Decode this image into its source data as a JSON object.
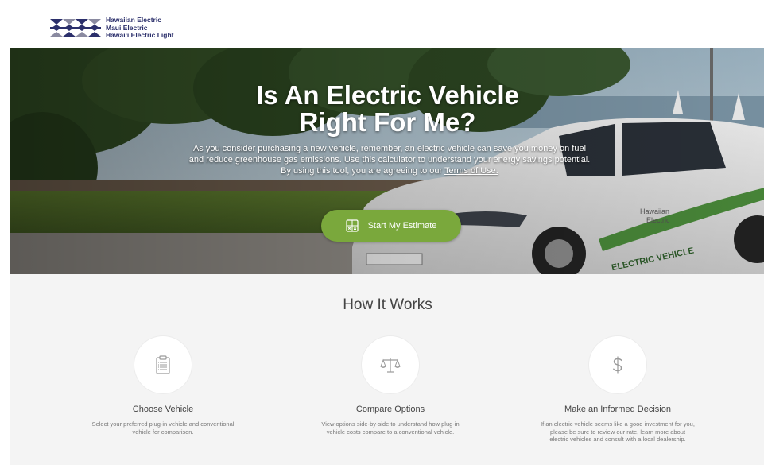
{
  "header": {
    "logo_lines": [
      "Hawaiian Electric",
      "Maui Electric",
      "Hawai‘i Electric Light"
    ]
  },
  "hero": {
    "title_line1": "Is An Electric Vehicle",
    "title_line2": "Right For Me?",
    "description": "As you consider purchasing a new vehicle, remember, an electric vehicle can save you money on fuel and reduce greenhouse gas emissions. Use this calculator to understand your energy savings potential. By using this tool, you are agreeing to our ",
    "terms_link": "Terms of Use.",
    "cta_label": "Start My Estimate",
    "cta_icon": "calculator-icon",
    "car_text_brand": "Hawaiian Electric",
    "car_text_decal": "ELECTRIC VEHICLE"
  },
  "how": {
    "title": "How It Works",
    "steps": [
      {
        "icon": "clipboard-icon",
        "title": "Choose Vehicle",
        "description": "Select your preferred plug-in vehicle and conventional vehicle for comparison."
      },
      {
        "icon": "scale-icon",
        "title": "Compare Options",
        "description": "View options side-by-side to understand how plug-in vehicle costs compare to a conventional vehicle."
      },
      {
        "icon": "dollar-icon",
        "title": "Make an Informed Decision",
        "description": "If an electric vehicle seems like a good investment for you, please be sure to review our rate, learn more about electric vehicles and consult with a local dealership."
      }
    ]
  },
  "colors": {
    "cta_green": "#7aa83c",
    "brand_navy": "#2b2f6b",
    "section_bg": "#f4f4f4"
  }
}
